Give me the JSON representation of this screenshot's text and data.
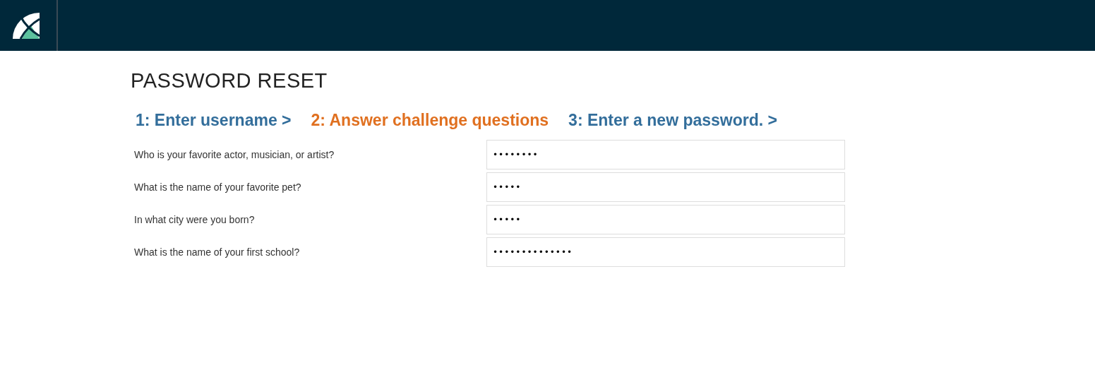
{
  "page_title": "PASSWORD RESET",
  "steps": [
    {
      "label": "1: Enter username >",
      "selected": false
    },
    {
      "label": "2: Answer challenge questions",
      "selected": true
    },
    {
      "label": "3: Enter a new password. >",
      "selected": false
    }
  ],
  "questions": [
    {
      "label": "Who is your favorite actor, musician, or artist?",
      "value": "••••••••"
    },
    {
      "label": "What is the name of your favorite pet?",
      "value": "•••••"
    },
    {
      "label": "In what city were you born?",
      "value": "•••••"
    },
    {
      "label": "What is the name of your first school?",
      "value": "••••••••••••••"
    }
  ]
}
